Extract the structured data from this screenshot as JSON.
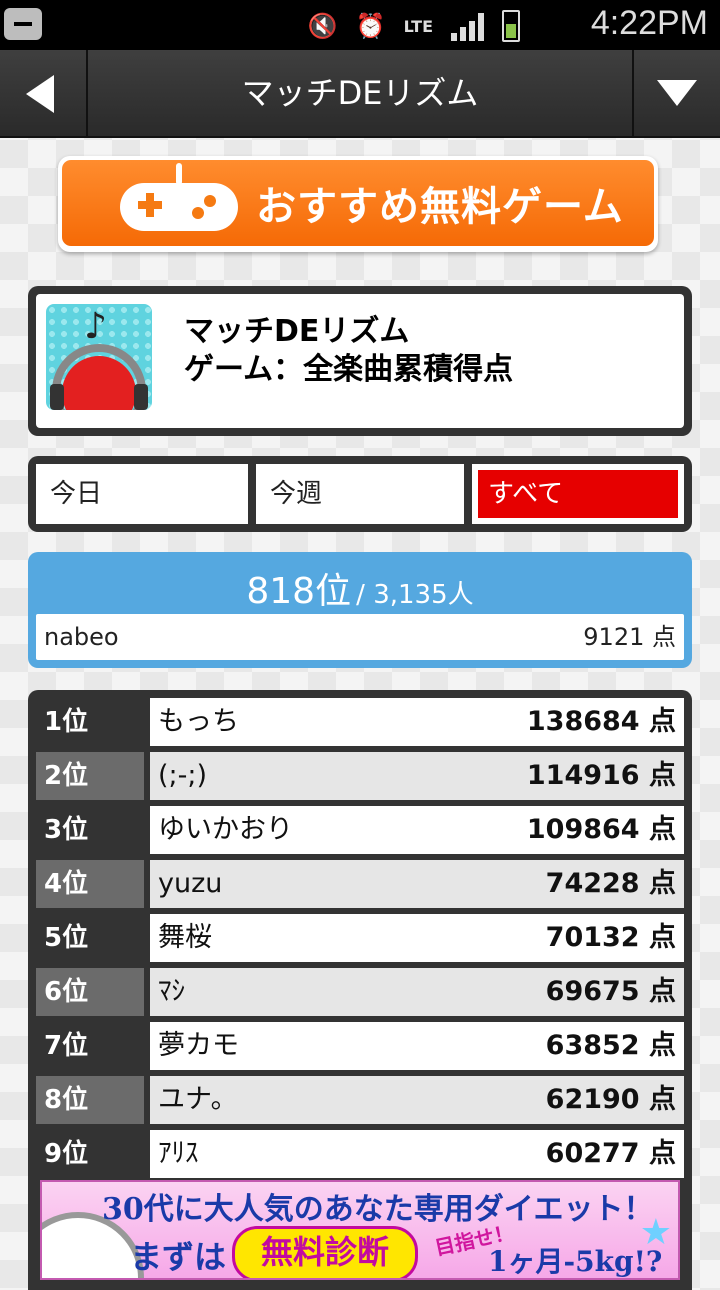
{
  "status_bar": {
    "time": "4:22PM",
    "network": "LTE",
    "icons": [
      "notification-icon",
      "mute-icon",
      "alarm-icon",
      "signal-icon",
      "battery-charging-icon"
    ]
  },
  "title_bar": {
    "title": "マッチDEリズム",
    "back_icon": "back-arrow-icon",
    "menu_icon": "dropdown-triangle-icon"
  },
  "promo": {
    "label": "おすすめ無料ゲーム",
    "icon": "gamepad-icon",
    "color": "#f57a12"
  },
  "game": {
    "name": "マッチDEリズム",
    "subtitle": "ゲーム：全楽曲累積得点"
  },
  "tabs": [
    {
      "label": "今日",
      "active": false
    },
    {
      "label": "今週",
      "active": false
    },
    {
      "label": "すべて",
      "active": true
    }
  ],
  "my_rank": {
    "rank": "818位",
    "total": "/ 3,135人",
    "name": "nabeo",
    "score": "9121 点"
  },
  "ranking": [
    {
      "rank": "1位",
      "name": "もっち",
      "score": "138684 点"
    },
    {
      "rank": "2位",
      "name": "(;-;)",
      "score": "114916 点"
    },
    {
      "rank": "3位",
      "name": "ゆいかおり",
      "score": "109864 点"
    },
    {
      "rank": "4位",
      "name": "yuzu",
      "score": "74228 点"
    },
    {
      "rank": "5位",
      "name": "舞桜",
      "score": "70132 点"
    },
    {
      "rank": "6位",
      "name": "ﾏｼ",
      "score": "69675 点"
    },
    {
      "rank": "7位",
      "name": "夢カモ",
      "score": "63852 点"
    },
    {
      "rank": "8位",
      "name": "ユナ。",
      "score": "62190 点"
    },
    {
      "rank": "9位",
      "name": "ｱﾘｽ",
      "score": "60277 点"
    }
  ],
  "ad": {
    "line1": "30代に大人気のあなた専用ダイエット！",
    "line2": "まずは",
    "badge": "無料診断",
    "tag": "目指せ！",
    "goal": "1ヶ月-5kg!?"
  },
  "colors": {
    "accent_tab": "#e60000",
    "my_rank_panel": "#55a8e0",
    "frame": "#333333"
  }
}
